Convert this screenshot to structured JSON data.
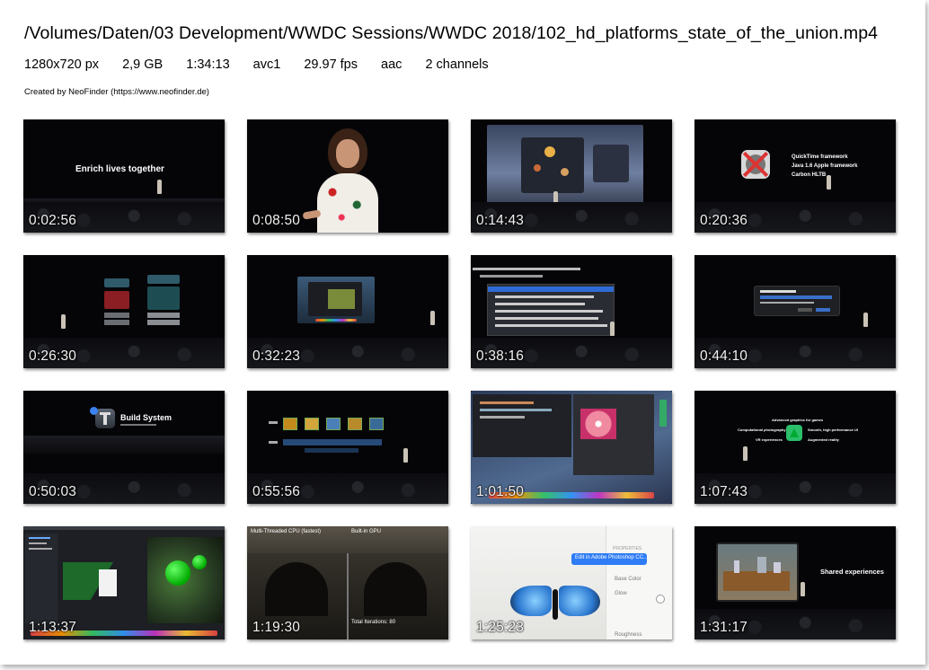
{
  "header": {
    "file_path": "/Volumes/Daten/03 Development/WWDC Sessions/WWDC 2018/102_hd_platforms_state_of_the_union.mp4",
    "resolution": "1280x720 px",
    "file_size": "2,9 GB",
    "duration": "1:34:13",
    "video_codec": "avc1",
    "frame_rate": "29.97 fps",
    "audio_codec": "aac",
    "audio_channels": "2 channels",
    "credit": "Created by NeoFinder (https://www.neofinder.de)"
  },
  "thumbnails": [
    {
      "timestamp": "0:02:56",
      "caption": "Enrich lives together"
    },
    {
      "timestamp": "0:08:50"
    },
    {
      "timestamp": "0:14:43"
    },
    {
      "timestamp": "0:20:36",
      "lines": [
        "QuickTime framework",
        "Java 1.6 Apple framework",
        "Carbon HLTB"
      ]
    },
    {
      "timestamp": "0:26:30"
    },
    {
      "timestamp": "0:32:23"
    },
    {
      "timestamp": "0:38:16"
    },
    {
      "timestamp": "0:44:10"
    },
    {
      "timestamp": "0:50:03",
      "caption": "Build System"
    },
    {
      "timestamp": "0:55:56"
    },
    {
      "timestamp": "1:01:50"
    },
    {
      "timestamp": "1:07:43",
      "lines": [
        "Advanced graphics for games",
        "Computational photography",
        "Smooth, high performance UI",
        "VR experiences",
        "Augmented reality"
      ]
    },
    {
      "timestamp": "1:13:37"
    },
    {
      "timestamp": "1:19:30",
      "labels": [
        "Multi-Threaded CPU (fastest)",
        "Built-in GPU",
        "Total Iterations: 80"
      ]
    },
    {
      "timestamp": "1:25:23",
      "lines": [
        "Edit in Adobe Photoshop CC...",
        "PROPERTIES",
        "Base Color",
        "Glow",
        "Roughness"
      ]
    },
    {
      "timestamp": "1:31:17",
      "caption": "Shared experiences"
    }
  ]
}
